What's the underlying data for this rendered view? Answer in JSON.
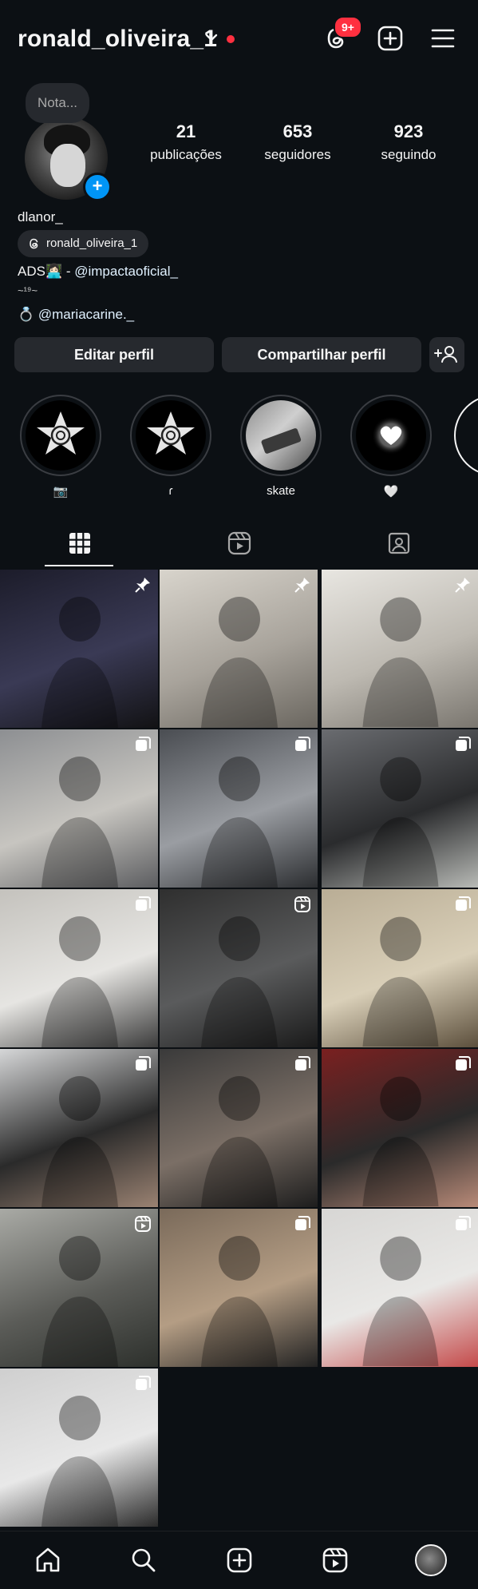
{
  "header": {
    "username": "ronald_oliveira_1",
    "notifications_badge": "9+"
  },
  "profile": {
    "note_placeholder": "Nota...",
    "stats": [
      {
        "value": "21",
        "label": "publicações"
      },
      {
        "value": "653",
        "label": "seguidores"
      },
      {
        "value": "923",
        "label": "seguindo"
      }
    ],
    "display_name": "dlanor_",
    "threads_handle": "ronald_oliveira_1",
    "bio_line1_prefix": "ADS👩🏻‍💻 - ",
    "bio_line1_mention": "@impactaoficial_",
    "bio_line2": "~¹⁹~",
    "bio_line3_prefix": "💍 ",
    "bio_line3_mention": "@mariacarine._"
  },
  "buttons": {
    "edit_profile": "Editar perfil",
    "share_profile": "Compartilhar perfil"
  },
  "highlights": [
    {
      "label": "📷"
    },
    {
      "label": "ɾ"
    },
    {
      "label": "skate"
    },
    {
      "label": "🤍"
    }
  ],
  "grid": {
    "cells": [
      {
        "pinned": true,
        "type": "post"
      },
      {
        "pinned": true,
        "type": "post"
      },
      {
        "pinned": true,
        "type": "post"
      },
      {
        "pinned": false,
        "type": "carousel"
      },
      {
        "pinned": false,
        "type": "carousel"
      },
      {
        "pinned": false,
        "type": "carousel"
      },
      {
        "pinned": false,
        "type": "carousel"
      },
      {
        "pinned": false,
        "type": "reel"
      },
      {
        "pinned": false,
        "type": "carousel"
      },
      {
        "pinned": false,
        "type": "carousel"
      },
      {
        "pinned": false,
        "type": "carousel"
      },
      {
        "pinned": false,
        "type": "carousel"
      },
      {
        "pinned": false,
        "type": "reel"
      },
      {
        "pinned": false,
        "type": "carousel"
      },
      {
        "pinned": false,
        "type": "carousel"
      },
      {
        "pinned": false,
        "type": "carousel"
      }
    ]
  },
  "colors": {
    "background": "#0c1014",
    "button": "#26292e",
    "accent_blue": "#0095f6",
    "alert_red": "#ff3040"
  },
  "icons": {
    "top": [
      "threads-icon",
      "create-icon",
      "menu-icon"
    ],
    "tabs": [
      "grid-icon",
      "reels-icon",
      "tagged-icon"
    ],
    "bottom": [
      "home-icon",
      "search-icon",
      "create-icon",
      "reels-icon",
      "profile-avatar"
    ]
  }
}
